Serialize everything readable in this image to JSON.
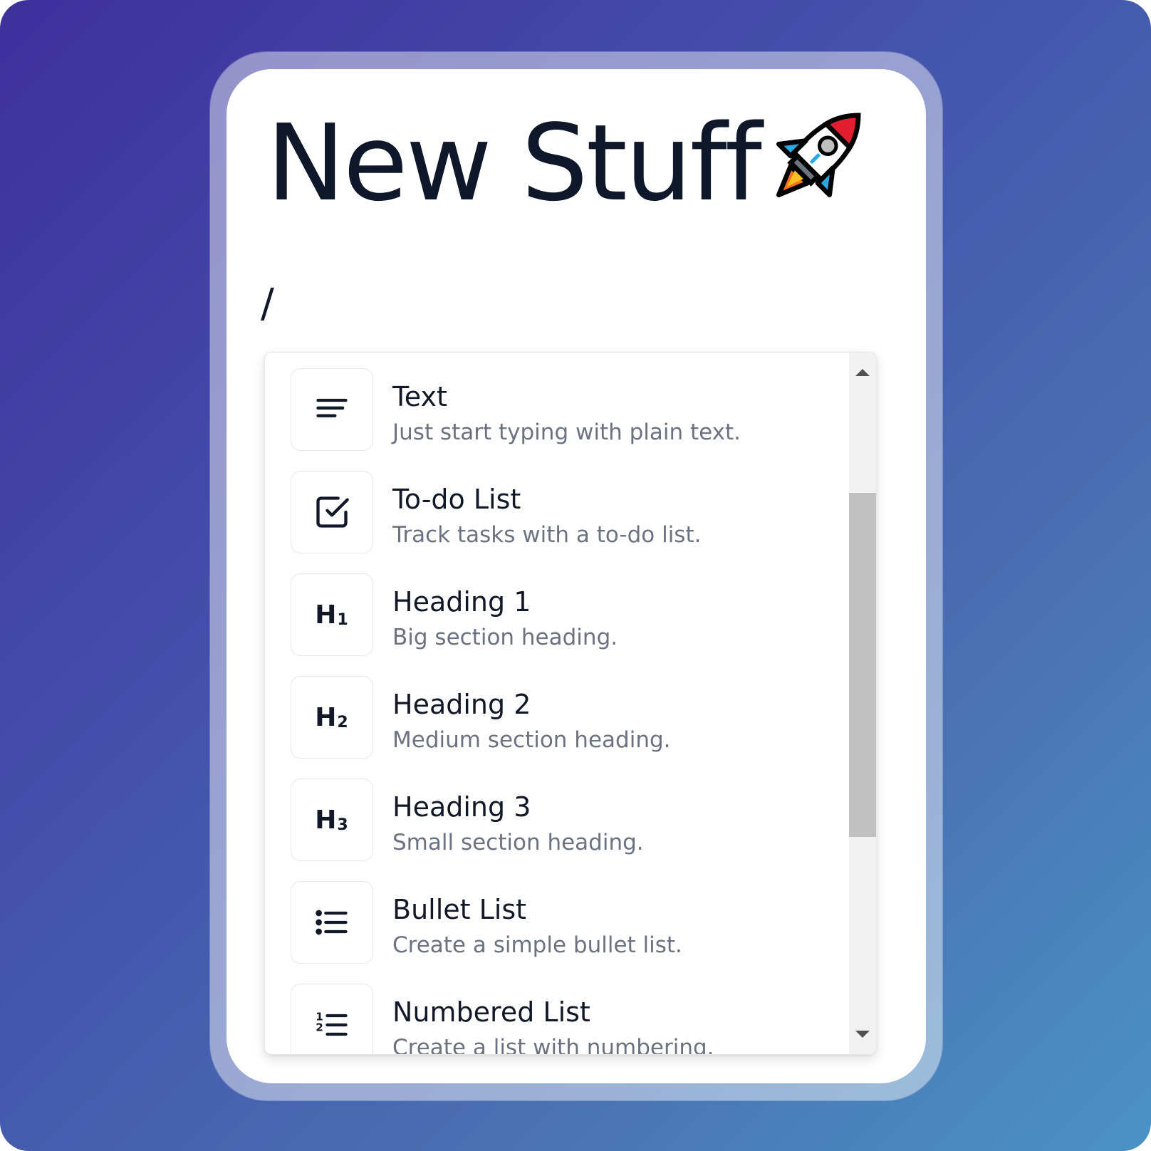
{
  "page": {
    "title": "New Stuff",
    "title_emoji": "rocket",
    "command_input": "/"
  },
  "menu": {
    "items": [
      {
        "label": "Text",
        "description": "Just start typing with plain text.",
        "icon": "text-lines-icon"
      },
      {
        "label": "To-do List",
        "description": "Track tasks with a to-do list.",
        "icon": "checkbox-icon"
      },
      {
        "label": "Heading 1",
        "description": "Big section heading.",
        "icon": "h1-icon",
        "icon_text": "H",
        "icon_sub": "1"
      },
      {
        "label": "Heading 2",
        "description": "Medium section heading.",
        "icon": "h2-icon",
        "icon_text": "H",
        "icon_sub": "2"
      },
      {
        "label": "Heading 3",
        "description": "Small section heading.",
        "icon": "h3-icon",
        "icon_text": "H",
        "icon_sub": "3"
      },
      {
        "label": "Bullet List",
        "description": "Create a simple bullet list.",
        "icon": "bullet-list-icon"
      },
      {
        "label": "Numbered List",
        "description": "Create a list with numbering.",
        "icon": "numbered-list-icon"
      }
    ],
    "scroll": {
      "thumb_fraction_start": 0.2,
      "thumb_fraction_size": 0.49
    }
  },
  "colors": {
    "background_gradient": [
      "#3f2f9c",
      "#4b93c4"
    ],
    "title_text": "#0f172a",
    "description_text": "#6b7280"
  }
}
